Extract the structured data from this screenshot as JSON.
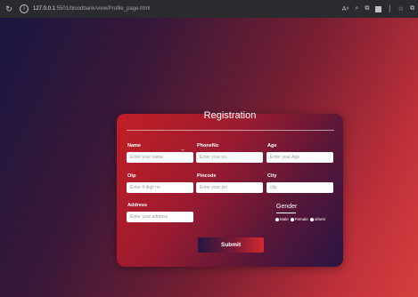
{
  "browser": {
    "reload_icon": "reload-icon",
    "info_icon": "info-icon",
    "url_host": "127.0.0.1",
    "url_path": ":5501/bloodbank/view/Profile_page.html",
    "actions": [
      "A",
      "Q",
      "☆",
      "■",
      "↓",
      "☆",
      "⚙"
    ]
  },
  "form": {
    "title": "Registration",
    "fields": {
      "name": {
        "label": "Name",
        "placeholder": "Enter your name"
      },
      "phone": {
        "label": "PhoneNo",
        "placeholder": "Enter your no"
      },
      "age": {
        "label": "Age",
        "placeholder": "Enter your Age"
      },
      "otp": {
        "label": "Otp",
        "placeholder": "Enter 4 digit no"
      },
      "pincode": {
        "label": "Pincode",
        "placeholder": "Enter your pin"
      },
      "city": {
        "label": "City",
        "placeholder": "city"
      },
      "address": {
        "label": "Address",
        "placeholder": "Enter your address"
      }
    },
    "gender": {
      "label": "Gender",
      "options": [
        "Male",
        "Female",
        "others"
      ]
    },
    "submit_label": "Submit"
  },
  "colors": {
    "card_start": "#c21f24",
    "card_end": "#2a1442",
    "background_left": "#1a1640",
    "background_right": "#d4403e"
  }
}
